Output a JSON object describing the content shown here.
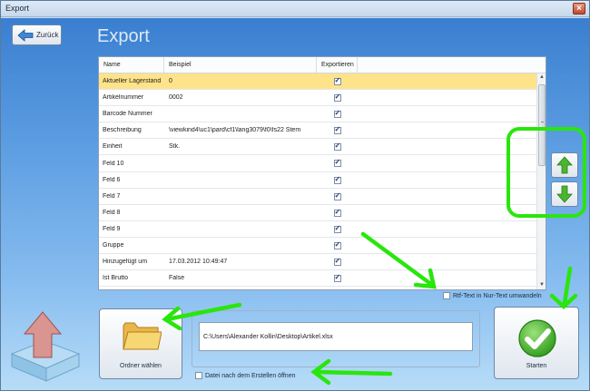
{
  "window": {
    "title": "Export",
    "close_label": "×"
  },
  "toolbar": {
    "back_label": "Zurück"
  },
  "page": {
    "title": "Export"
  },
  "grid": {
    "columns": [
      "Name",
      "Beispiel",
      "Exportieren"
    ],
    "rows": [
      {
        "name": "Aktueller Lagerstand",
        "example": "0",
        "export": true,
        "selected": true
      },
      {
        "name": "Artikelnummer",
        "example": "0002",
        "export": true
      },
      {
        "name": "Barcode Nummer",
        "example": "",
        "export": true
      },
      {
        "name": "Beschreibung",
        "example": "\\viewkind4\\uc1\\pard\\cf1\\lang3079\\f0\\fs22 Stem",
        "export": true
      },
      {
        "name": "Einheit",
        "example": "Stk.",
        "export": true
      },
      {
        "name": "Feld 10",
        "example": "",
        "export": true
      },
      {
        "name": "Feld 6",
        "example": "",
        "export": true
      },
      {
        "name": "Feld 7",
        "example": "",
        "export": true
      },
      {
        "name": "Feld 8",
        "example": "",
        "export": true
      },
      {
        "name": "Feld 9",
        "example": "",
        "export": true
      },
      {
        "name": "Gruppe",
        "example": "",
        "export": true
      },
      {
        "name": "Hinzugefügt um",
        "example": "17.03.2012 10:49:47",
        "export": true
      },
      {
        "name": "Ist Brutto",
        "example": "False",
        "export": true
      }
    ]
  },
  "options": {
    "rtf_label": "Rtf-Text in Nur-Text umwandeln",
    "open_after_label": "Datei nach dem Erstellen öffnen"
  },
  "file": {
    "path": "C:\\Users\\Alexander Kollin\\Desktop\\Artikel.xlsx"
  },
  "buttons": {
    "folder_label": "Ordner wählen",
    "start_label": "Starten"
  },
  "colors": {
    "highlight": "#ffe38a",
    "annotation": "#29e60d"
  }
}
